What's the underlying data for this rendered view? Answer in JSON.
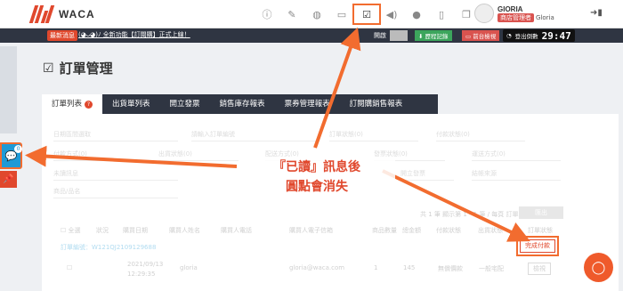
{
  "brand": {
    "name": "WACA"
  },
  "topbar": {
    "icons": [
      "info-icon",
      "edit-icon",
      "palette-icon",
      "store-icon",
      "checklist-icon",
      "speaker-icon",
      "user-icon",
      "file-icon",
      "copy-icon"
    ],
    "profile_name": "GIORIA",
    "role_badge": "商店管理者",
    "user_name": "Gloria"
  },
  "newsbar": {
    "tag": "最新消息",
    "text": "(◕ᴗ◕)ﾉ 全新功能【訂閱購】正式上線！",
    "select_label": "開啟",
    "history_button": "歷程記錄",
    "preview_button": "前台檢視",
    "timer_label": "登出倒數",
    "timer_value": "29:47"
  },
  "page": {
    "title": "訂單管理"
  },
  "tabs": [
    "訂單列表",
    "出貨單列表",
    "開立發票",
    "銷售庫存報表",
    "票券管理報表",
    "訂閱購銷售報表"
  ],
  "filters": {
    "row1": [
      "日期區間選取",
      "請輸入訂單編號",
      "訂單狀態(0)",
      "付款狀態(0)"
    ],
    "row2": [
      "付款方式(0)",
      "出貨狀態(0)",
      "配送方式(0)",
      "發票狀態(0)",
      "運送方式(0)"
    ],
    "row3": [
      "未讀訊息",
      "開立發票",
      "結帳來源"
    ],
    "row4": [
      "商品/品名"
    ]
  },
  "table": {
    "headers": [
      "全選",
      "狀況",
      "購買日期",
      "購買人姓名",
      "購買人電話",
      "購買人電子信箱",
      "商品數量",
      "總金額",
      "付款狀態",
      "出貨狀態",
      "訂單狀態"
    ],
    "order_label": "訂單編號：",
    "order_no": "W121QJ2109129688",
    "row": {
      "date": "2021/09/13",
      "time": "12:29:35",
      "name": "gloria",
      "email": "gloria@waca.com",
      "qty": "1",
      "total": "145",
      "pay": "無償價款",
      "ship": "一般宅配"
    },
    "toolbar_text": "共 1 筆 顯示第 1 - 1 筆 / 每頁 訂單",
    "gray_button": "匯出",
    "pay_button": "完成付款",
    "row_button": "檢視"
  },
  "annotation": {
    "line1": "『已讀』訊息後",
    "line2": "圓點會消失"
  },
  "chat_badge": "0",
  "colors": {
    "accent": "#f26c2f",
    "brand_red": "#e0482d",
    "dark": "#2f3542"
  }
}
